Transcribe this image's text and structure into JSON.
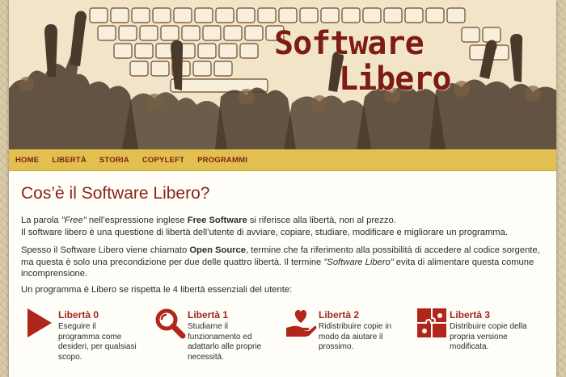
{
  "header": {
    "title_line1": "Software",
    "title_line2": "Libero"
  },
  "nav": {
    "items": [
      "HOME",
      "LIBERTÀ",
      "STORIA",
      "COPYLEFT",
      "PROGRAMMI"
    ]
  },
  "main": {
    "heading": "Cos’è il Software Libero?",
    "p1_a": "La parola ",
    "p1_free": "\"Free\"",
    "p1_b": " nell’espressione inglese ",
    "p1_fs": "Free Software",
    "p1_c": " si riferisce alla libertà, non al prezzo.",
    "p1_line2": "Il software libero è una questione di libertà dell’utente di avviare, copiare, studiare, modificare e migliorare un programma.",
    "p2_a": "Spesso il Software Libero viene chiamato ",
    "p2_os": "Open Source",
    "p2_b": ", termine che fa riferimento alla possibilità di accedere al codice sorgente, ma questa è solo una precondizione per due delle quattro libertà. Il termine ",
    "p2_sl": "\"Software Libero\"",
    "p2_c": " evita di alimentare questa comune incomprensione.",
    "p3": "Un programma è Libero se rispetta le 4 libertà essenziali del utente:"
  },
  "freedoms": [
    {
      "title": "Libertà 0",
      "desc": "Eseguire il programma come desideri, per qualsiasi scopo.",
      "icon": "play-icon"
    },
    {
      "title": "Libertà 1",
      "desc": "Studiarne il funzionamento ed adattarlo alle proprie necessità.",
      "icon": "magnifier-icon"
    },
    {
      "title": "Libertà 2",
      "desc": "Ridistribuire copie in modo da aiutare il prossimo.",
      "icon": "heart-hand-icon"
    },
    {
      "title": "Libertà 3",
      "desc": "Distribuire copie della propria versione modificata.",
      "icon": "puzzle-icon"
    }
  ],
  "colors": {
    "accent": "#a3251a",
    "nav_bg": "#e2c04f",
    "banner_bg": "#efe0c4"
  }
}
